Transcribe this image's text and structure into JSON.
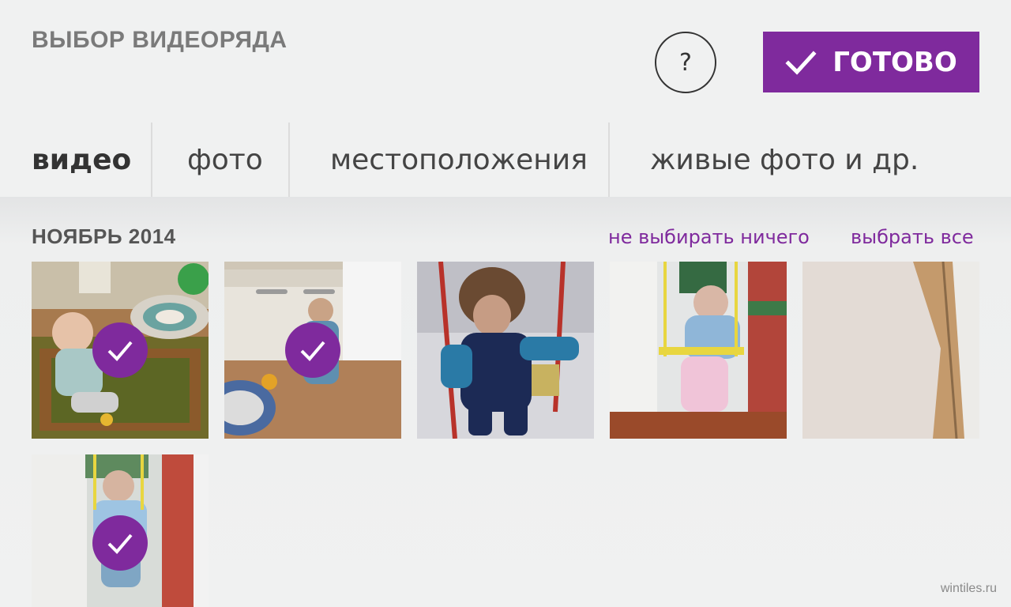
{
  "header": {
    "title": "ВЫБОР ВИДЕОРЯДА",
    "help_label": "?",
    "done_label": "ГОТОВО"
  },
  "tabs": [
    {
      "label": "видео",
      "active": true
    },
    {
      "label": "фото",
      "active": false
    },
    {
      "label": "местоположения",
      "active": false
    },
    {
      "label": "живые фото и др.",
      "active": false
    }
  ],
  "group": {
    "title": "НОЯБРЬ 2014",
    "select_none_label": "не выбирать ничего",
    "select_all_label": "выбрать все"
  },
  "thumbnails": [
    {
      "selected": true
    },
    {
      "selected": true
    },
    {
      "selected": false
    },
    {
      "selected": false
    },
    {
      "selected": false
    },
    {
      "selected": true
    }
  ],
  "watermark": "wintiles.ru",
  "colors": {
    "accent": "#7f2a9d",
    "background": "#f0f1f1",
    "title_gray": "#7a7a7a"
  },
  "icons": {
    "help": "question-circle-icon",
    "done": "check-icon",
    "selected": "check-badge-icon"
  }
}
